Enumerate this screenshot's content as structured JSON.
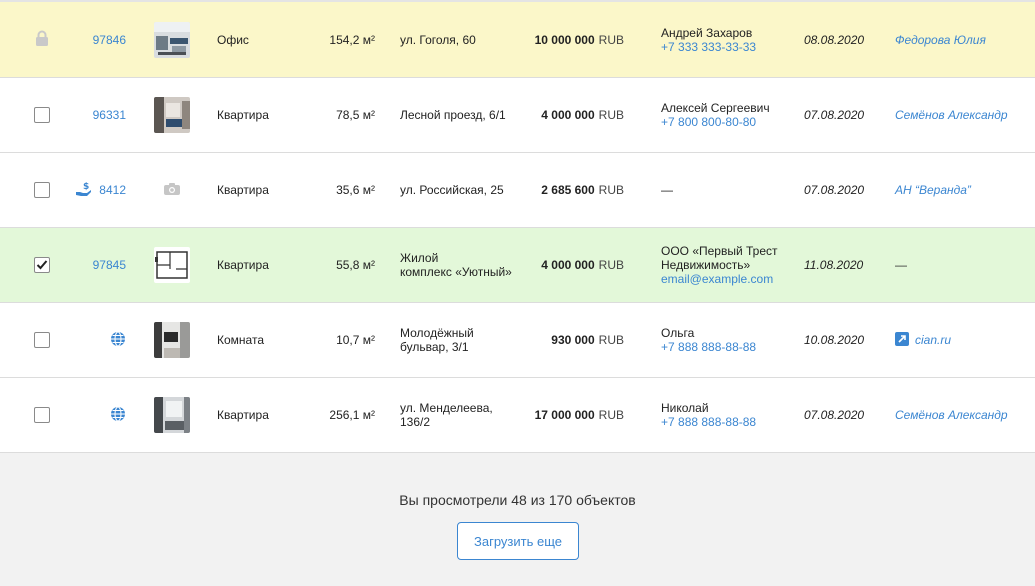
{
  "currency": "RUB",
  "rows": [
    {
      "id": "97846",
      "type": "Офис",
      "area": "154,2 м²",
      "address": [
        "ул. Гоголя, 60",
        ""
      ],
      "price": "10 000 000",
      "contact_name": "Андрей Захаров",
      "contact_extra": "+7 333 333-33-33",
      "date": "08.08.2020",
      "agent": "Федорова Юлия"
    },
    {
      "id": "96331",
      "type": "Квартира",
      "area": "78,5 м²",
      "address": [
        "Лесной проезд, 6/1",
        ""
      ],
      "price": "4 000 000",
      "contact_name": "Алексей Сергеевич",
      "contact_extra": "+7 800 800-80-80",
      "date": "07.08.2020",
      "agent": "Семёнов Александр"
    },
    {
      "id": "8412",
      "type": "Квартира",
      "area": "35,6 м²",
      "address": [
        "ул. Российская, 25",
        ""
      ],
      "price": "2 685 600",
      "contact_name": "—",
      "contact_extra": "",
      "date": "07.08.2020",
      "agent": "АН “Веранда”"
    },
    {
      "id": "97845",
      "type": "Квартира",
      "area": "55,8 м²",
      "address": [
        "Жилой",
        "комплекс «Уютный»"
      ],
      "price": "4 000 000",
      "contact_name": "ООО «Первый Трест",
      "contact_name2": "Недвижимость»",
      "contact_extra": "email@example.com",
      "date": "11.08.2020",
      "agent": "—"
    },
    {
      "id": "",
      "type": "Комната",
      "area": "10,7 м²",
      "address": [
        "Молодёжный",
        "бульвар, 3/1"
      ],
      "price": "930 000",
      "contact_name": "Ольга",
      "contact_extra": "+7 888 888-88-88",
      "date": "10.08.2020",
      "agent": "cian.ru"
    },
    {
      "id": "",
      "type": "Квартира",
      "area": "256,1 м²",
      "address": [
        "ул. Менделеева,",
        "136/2"
      ],
      "price": "17 000 000",
      "contact_name": "Николай",
      "contact_extra": "+7 888 888-88-88",
      "date": "07.08.2020",
      "agent": "Семёнов Александр"
    }
  ],
  "footer": {
    "viewed_text": "Вы просмотрели 48 из 170 объектов",
    "load_more": "Загрузить еще"
  },
  "colors": {
    "accent": "#3b86d1",
    "row_yellow": "#fbf7c9",
    "row_green": "#e3f8d9"
  },
  "icons": {
    "locked": "lock-icon",
    "commission": "hand-dollar-icon",
    "no_photo": "camera-icon",
    "web_source": "globe-icon",
    "external": "external-link-icon",
    "check": "check-icon"
  }
}
